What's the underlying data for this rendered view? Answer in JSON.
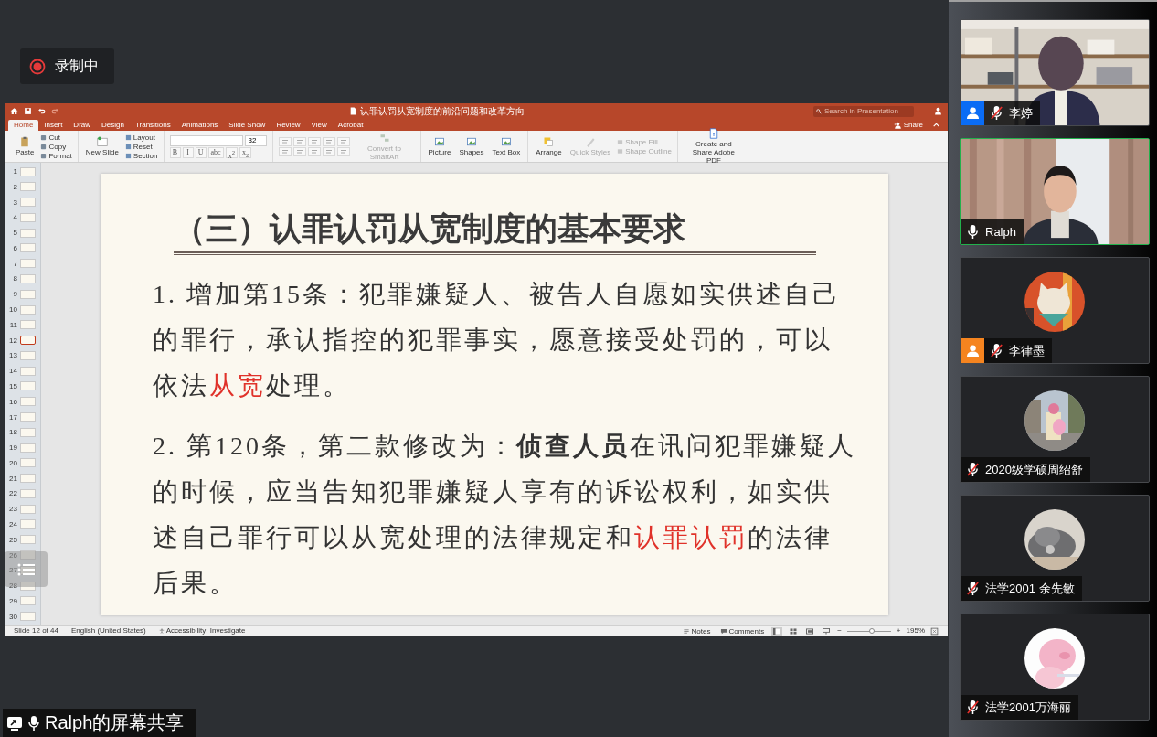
{
  "recording": {
    "label": "录制中"
  },
  "presentation": {
    "title": "认罪认罚从宽制度的前沿问题和改革方向",
    "search": {
      "placeholder": "Search in Presentation"
    },
    "tabs": [
      {
        "label": "Home",
        "selected": true
      },
      {
        "label": "Insert",
        "selected": false
      },
      {
        "label": "Draw",
        "selected": false
      },
      {
        "label": "Design",
        "selected": false
      },
      {
        "label": "Transitions",
        "selected": false
      },
      {
        "label": "Animations",
        "selected": false
      },
      {
        "label": "Slide Show",
        "selected": false
      },
      {
        "label": "Review",
        "selected": false
      },
      {
        "label": "View",
        "selected": false
      },
      {
        "label": "Acrobat",
        "selected": false
      }
    ],
    "share": "Share",
    "ribbon": {
      "paste": "Paste",
      "clipboard": [
        "Cut",
        "Copy",
        "Format"
      ],
      "new_slide": "New Slide",
      "slide_tools": [
        "Layout",
        "Reset",
        "Section"
      ],
      "font_size": "32",
      "format_buttons": [
        "B",
        "I",
        "U",
        "abc",
        "x$^{2}$",
        "x$_{2}$"
      ],
      "smartart": {
        "label": "Convert to SmartArt",
        "disabled": true
      },
      "insert": [
        "Picture",
        "Shapes",
        "Text Box"
      ],
      "arrange": {
        "label": "Arrange",
        "disabled": false
      },
      "quick_styles": {
        "label": "Quick Styles",
        "disabled": true
      },
      "shape_tools": [
        {
          "label": "Shape Fill",
          "disabled": true
        },
        {
          "label": "Shape Outline",
          "disabled": true
        }
      ],
      "pdf": "Create and Share Adobe PDF"
    },
    "thumbnails": [
      {
        "number": "1",
        "selected": false
      },
      {
        "number": "2",
        "selected": false
      },
      {
        "number": "3",
        "selected": false
      },
      {
        "number": "4",
        "selected": false
      },
      {
        "number": "5",
        "selected": false
      },
      {
        "number": "6",
        "selected": false
      },
      {
        "number": "7",
        "selected": false
      },
      {
        "number": "8",
        "selected": false
      },
      {
        "number": "9",
        "selected": false
      },
      {
        "number": "10",
        "selected": false
      },
      {
        "number": "11",
        "selected": false
      },
      {
        "number": "12",
        "selected": true
      },
      {
        "number": "13",
        "selected": false
      },
      {
        "number": "14",
        "selected": false
      },
      {
        "number": "15",
        "selected": false
      },
      {
        "number": "16",
        "selected": false
      },
      {
        "number": "17",
        "selected": false
      },
      {
        "number": "18",
        "selected": false
      },
      {
        "number": "19",
        "selected": false
      },
      {
        "number": "20",
        "selected": false
      },
      {
        "number": "21",
        "selected": false
      },
      {
        "number": "22",
        "selected": false
      },
      {
        "number": "23",
        "selected": false
      },
      {
        "number": "24",
        "selected": false
      },
      {
        "number": "25",
        "selected": false
      },
      {
        "number": "26",
        "selected": false
      },
      {
        "number": "27",
        "selected": false
      },
      {
        "number": "28",
        "selected": false
      },
      {
        "number": "29",
        "selected": false
      },
      {
        "number": "30",
        "selected": false
      }
    ],
    "slide": {
      "title": "（三）认罪认罚从宽制度的基本要求",
      "paragraphs": [
        [
          {
            "text": "1. 增加第15条：犯罪嫌疑人、被告人自愿如实供述自己的罪行，承认指控的犯罪事实，愿意接受处罚的，可以依法",
            "kind": "plain"
          },
          {
            "text": "从宽",
            "kind": "highlight"
          },
          {
            "text": "处理。",
            "kind": "plain"
          }
        ],
        [
          {
            "text": "2. 第120条，第二款修改为：",
            "kind": "plain"
          },
          {
            "text": "侦查人员",
            "kind": "emphasis"
          },
          {
            "text": "在讯问犯罪嫌疑人的时候，应当告知犯罪嫌疑人享有的诉讼权利，如实供述自己罪行可以从宽处理的法律规定和",
            "kind": "plain"
          },
          {
            "text": "认罪认罚",
            "kind": "highlight"
          },
          {
            "text": "的法律后果。",
            "kind": "plain"
          }
        ]
      ]
    },
    "status": {
      "slide": "Slide 12 of 44",
      "language": "English (United States)",
      "accessibility": "Accessibility: Investigate",
      "notes": "Notes",
      "comments": "Comments",
      "views": [
        {
          "kind": "normal",
          "selected": true
        },
        {
          "kind": "sorter",
          "selected": false
        },
        {
          "kind": "reading",
          "selected": false
        },
        {
          "kind": "slideshow",
          "selected": false
        }
      ],
      "zoom_out": "−",
      "zoom_in": "+",
      "zoom": {
        "level": 0.56
      },
      "zoom_label": "195%"
    }
  },
  "share_label": "Ralph的屏幕共享",
  "participants": [
    {
      "name": "李婷",
      "muted": true,
      "color": "#0a6cf5",
      "kind": "video",
      "speaking": false
    },
    {
      "name": "Ralph",
      "muted": false,
      "kind": "video",
      "speaking": true
    },
    {
      "name": "李律墨",
      "muted": true,
      "color": "#f5841f",
      "kind": "avatar",
      "speaking": false
    },
    {
      "name": "2020级学硕周绍舒",
      "muted": true,
      "kind": "avatar",
      "speaking": false
    },
    {
      "name": "法学2001 余先敏",
      "muted": true,
      "kind": "avatar",
      "speaking": false
    },
    {
      "name": "法学2001万海丽",
      "muted": true,
      "kind": "avatar",
      "speaking": false
    }
  ]
}
